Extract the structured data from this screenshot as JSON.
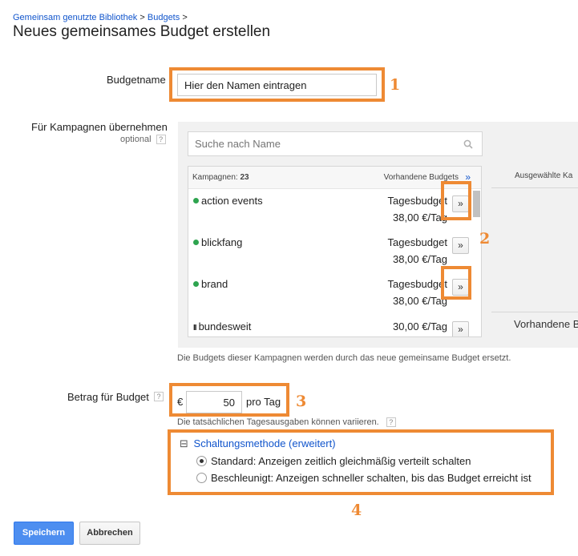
{
  "breadcrumb": {
    "items": [
      "Gemeinsam genutzte Bibliothek",
      "Budgets"
    ],
    "separator": ">"
  },
  "page_title": "Neues gemeinsames Budget erstellen",
  "budget_name": {
    "label": "Budgetname",
    "value": "Hier den Namen eintragen"
  },
  "campaigns": {
    "label": "Für Kampagnen übernehmen",
    "optional": "optional",
    "help": "?",
    "search_placeholder": "Suche nach Name",
    "count_label": "Kampagnen:",
    "count": "23",
    "existing_budgets_label": "Vorhandene Budgets",
    "add_all": "»",
    "selected_header": "Ausgewählte Ka",
    "selected_footer": "Vorhandene B",
    "add_label": "»",
    "items": [
      {
        "name": "action events",
        "status": "active",
        "budget_type": "Tagesbudget",
        "amount": "38,00 €/Tag"
      },
      {
        "name": "blickfang",
        "status": "active",
        "budget_type": "Tagesbudget",
        "amount": "38,00 €/Tag"
      },
      {
        "name": "brand",
        "status": "active",
        "budget_type": "Tagesbudget",
        "amount": "38,00 €/Tag"
      },
      {
        "name": "bundesweit",
        "status": "paused",
        "budget_type": "",
        "amount": "30,00 €/Tag"
      }
    ],
    "note": "Die Budgets dieser Kampagnen werden durch das neue gemeinsame Budget ersetzt."
  },
  "amount": {
    "label": "Betrag für Budget",
    "help": "?",
    "currency": "€",
    "value": "50",
    "unit": "pro Tag",
    "hint": "Die tatsächlichen Tagesausgaben können variieren."
  },
  "delivery": {
    "toggle": "⊟",
    "title": "Schaltungsmethode (erweitert)",
    "options": [
      {
        "label": "Standard: Anzeigen zeitlich gleichmäßig verteilt schalten",
        "selected": true
      },
      {
        "label": "Beschleunigt: Anzeigen schneller schalten, bis das Budget erreicht ist",
        "selected": false
      }
    ]
  },
  "annotations": [
    "1",
    "2",
    "3",
    "4"
  ],
  "buttons": {
    "save": "Speichern",
    "cancel": "Abbrechen"
  },
  "colors": {
    "highlight": "#ee8a34",
    "link": "#1155cc",
    "primary": "#4d8ef0",
    "status_active": "#2ea44f"
  }
}
